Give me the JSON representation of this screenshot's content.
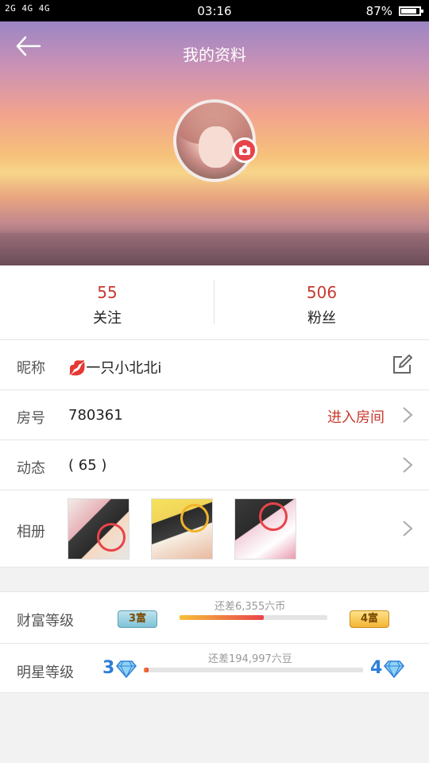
{
  "status_bar": {
    "left": "2G 4G 4G",
    "time": "03:16",
    "battery": "87%",
    "battery_level": 0.87
  },
  "header": {
    "title": "我的资料",
    "back_icon": "arrow-left-icon",
    "camera_icon": "camera-icon"
  },
  "stats": [
    {
      "value": "55",
      "label": "关注"
    },
    {
      "value": "506",
      "label": "粉丝"
    }
  ],
  "profile": {
    "nickname_label": "昵称",
    "nickname": "💋一只小北北i",
    "room_label": "房号",
    "room_value": "780361",
    "enter_room": "进入房间",
    "moments_label": "动态",
    "moments_value": "( 65 )",
    "album_label": "相册"
  },
  "levels": {
    "wealth": {
      "label": "财富等级",
      "hint": "还差6,355六币",
      "current_badge": "3富",
      "next_badge": "4富",
      "progress": 0.57,
      "colors": [
        "#f7c03a",
        "#e8434a"
      ]
    },
    "star": {
      "label": "明星等级",
      "hint": "还差194,997六豆",
      "current_level": "3",
      "next_level": "4",
      "progress": 0.02,
      "colors": [
        "#f08a2b",
        "#e8434a"
      ]
    }
  }
}
